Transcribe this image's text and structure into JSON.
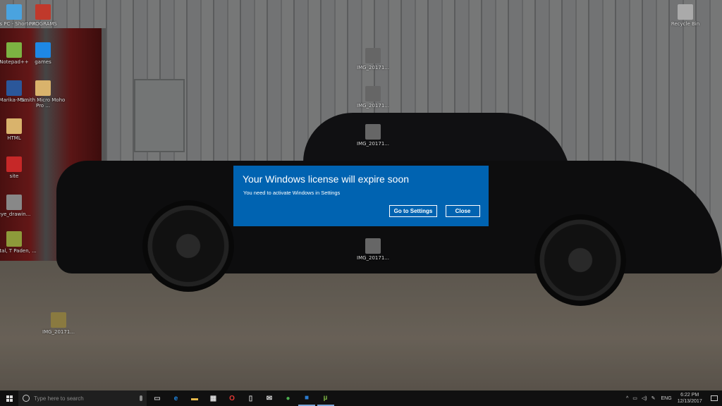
{
  "desktop": {
    "icons": [
      {
        "label": "This PC - Shortcut",
        "icon": "monitor-icon",
        "color": "#4aa3df"
      },
      {
        "label": "PROGRAMS",
        "icon": "programs-icon",
        "color": "#c0392b"
      },
      {
        "label": "Notepad++",
        "icon": "notepad-icon",
        "color": "#7cb342"
      },
      {
        "label": "games",
        "icon": "folder-icon",
        "color": "#1e88e5"
      },
      {
        "label": "Marika-Ma...",
        "icon": "word-icon",
        "color": "#2b579a"
      },
      {
        "label": "Smith Micro Moho Pro ...",
        "icon": "folder-icon",
        "color": "#d9b36c"
      },
      {
        "label": "HTML",
        "icon": "folder-icon",
        "color": "#d9b36c"
      },
      {
        "label": "site",
        "icon": "folder-icon",
        "color": "#c62828"
      },
      {
        "label": "eye_drawin...",
        "icon": "image-icon",
        "color": "#888888"
      },
      {
        "label": "Portal, T Paden, ...",
        "icon": "image-icon",
        "color": "#8d9a3a"
      },
      {
        "label": "IMG_20171...",
        "icon": "image-icon",
        "color": "#666666"
      },
      {
        "label": "IMG_20171...",
        "icon": "image-icon",
        "color": "#666666"
      },
      {
        "label": "IMG_20171...",
        "icon": "image-icon",
        "color": "#666666"
      },
      {
        "label": "IMG_20171...",
        "icon": "image-icon",
        "color": "#666666"
      },
      {
        "label": "IMG_20171...",
        "icon": "video-icon",
        "color": "#8a7a40"
      },
      {
        "label": "Recycle Bin",
        "icon": "recycle-bin-icon",
        "color": "#aaaaaa"
      }
    ]
  },
  "dialog": {
    "title": "Your Windows license will expire soon",
    "message": "You need to activate Windows in Settings",
    "primary": "Go to Settings",
    "secondary": "Close",
    "accent": "#0063b1"
  },
  "taskbar": {
    "search_placeholder": "Type here to search",
    "apps": [
      "task-view-icon",
      "edge-icon",
      "file-explorer-icon",
      "store-icon",
      "opera-icon",
      "document-icon",
      "mail-icon",
      "chrome-icon",
      "app-icon",
      "utorrent-icon"
    ],
    "language": "ENG",
    "time": "6:22 PM",
    "date": "12/13/2017"
  }
}
